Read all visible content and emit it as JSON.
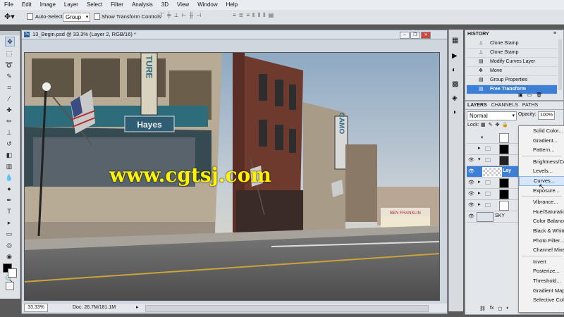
{
  "menu": [
    "File",
    "Edit",
    "Image",
    "Layer",
    "Select",
    "Filter",
    "Analysis",
    "3D",
    "View",
    "Window",
    "Help"
  ],
  "options": {
    "auto_select_label": "Auto-Select:",
    "auto_select_value": "Group",
    "show_transform_label": "Show Transform Controls"
  },
  "document": {
    "title": "13_Begin.psd @ 33.3% (Layer 2, RGB/16) *",
    "zoom": "33.33%",
    "doc_info": "Doc: 26.7M/181.1M"
  },
  "canvas": {
    "watermark": "www.cgtsj.com",
    "sign_hayes": "Hayes",
    "sign_ture": "TURE",
    "sign_camo": "CAMO",
    "sign_franklin": "BEN FRANKLIN"
  },
  "history": {
    "tab": "HISTORY",
    "items": [
      "Clone Stamp",
      "Clone Stamp",
      "Modify Curves Layer",
      "Move",
      "Group Properties",
      "Free Transform"
    ],
    "selected_index": 5
  },
  "layers": {
    "tabs": [
      "LAYERS",
      "CHANNELS",
      "PATHS"
    ],
    "blend_mode": "Normal",
    "opacity_label": "Opacity:",
    "opacity_value": "100%",
    "lock_label": "Lock:",
    "rows": [
      {
        "name": ""
      },
      {
        "name": ""
      },
      {
        "name": ""
      },
      {
        "name": "Lay"
      },
      {
        "name": ""
      },
      {
        "name": ""
      },
      {
        "name": ""
      },
      {
        "name": "SKY"
      }
    ]
  },
  "context_menu": {
    "items": [
      "Solid Color...",
      "Gradient...",
      "Pattern...",
      "Brightness/Contrast...",
      "Levels...",
      "Curves...",
      "Exposure...",
      "Vibrance...",
      "Hue/Saturation...",
      "Color Balance...",
      "Black & White...",
      "Photo Filter...",
      "Channel Mixer...",
      "Invert",
      "Posterize...",
      "Threshold...",
      "Gradient Map...",
      "Selective Color..."
    ],
    "highlighted": "Curves..."
  },
  "colors": {
    "accent": "#3d7fd6",
    "watermark": "#fff200",
    "ui_bg": "#e3e6ea"
  }
}
